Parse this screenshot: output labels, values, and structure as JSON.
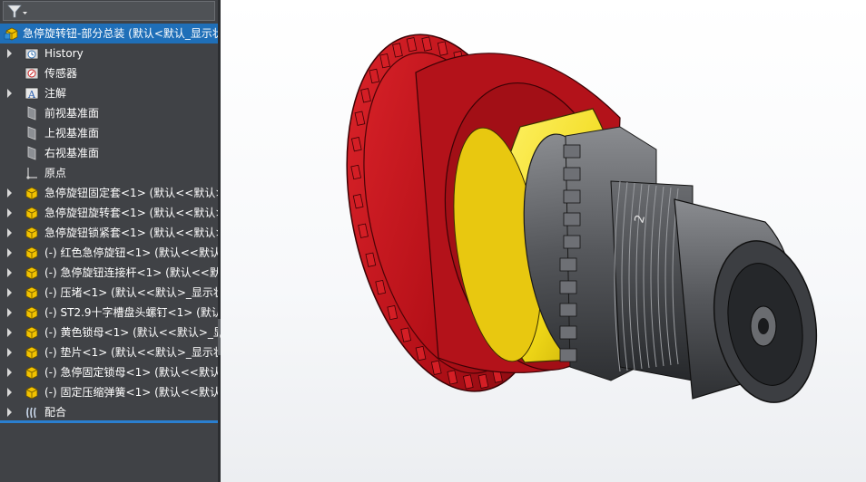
{
  "feature_tree": {
    "root": {
      "label": "急停旋转钮-部分总装  (默认<默认_显示状"
    },
    "items": [
      {
        "label": "History",
        "icon": "history-folder-icon",
        "expandable": true
      },
      {
        "label": "传感器",
        "icon": "sensor-icon",
        "expandable": false
      },
      {
        "label": "注解",
        "icon": "annotation-icon",
        "expandable": true
      },
      {
        "label": "前视基准面",
        "icon": "plane-icon",
        "expandable": false
      },
      {
        "label": "上视基准面",
        "icon": "plane-icon",
        "expandable": false
      },
      {
        "label": "右视基准面",
        "icon": "plane-icon",
        "expandable": false
      },
      {
        "label": "原点",
        "icon": "origin-icon",
        "expandable": false
      },
      {
        "label": "急停旋钮固定套<1> (默认<<默认>",
        "icon": "part-icon",
        "expandable": true
      },
      {
        "label": "急停旋钮旋转套<1> (默认<<默认>",
        "icon": "part-icon",
        "expandable": true
      },
      {
        "label": "急停旋钮锁紧套<1> (默认<<默认>",
        "icon": "part-icon",
        "expandable": true
      },
      {
        "label": "(-) 红色急停旋钮<1> (默认<<默认",
        "icon": "part-icon",
        "expandable": true
      },
      {
        "label": "(-) 急停旋钮连接杆<1> (默认<<默",
        "icon": "part-icon",
        "expandable": true
      },
      {
        "label": "(-) 压堵<1> (默认<<默认>_显示状",
        "icon": "part-icon",
        "expandable": true
      },
      {
        "label": "(-) ST2.9十字槽盘头螺钉<1> (默认",
        "icon": "part-icon",
        "expandable": true
      },
      {
        "label": "(-) 黄色锁母<1> (默认<<默认>_显",
        "icon": "part-icon",
        "expandable": true
      },
      {
        "label": "(-) 垫片<1> (默认<<默认>_显示状",
        "icon": "part-icon",
        "expandable": true
      },
      {
        "label": "(-) 急停固定锁母<1> (默认<<默认",
        "icon": "part-icon",
        "expandable": true
      },
      {
        "label": "(-) 固定压缩弹簧<1> (默认<<默认",
        "icon": "part-icon",
        "expandable": true
      },
      {
        "label": "配合",
        "icon": "mates-icon",
        "expandable": true
      }
    ]
  },
  "model": {
    "thread_marking": "2",
    "colors": {
      "button_red": "#c8141c",
      "lock_yellow": "#f5e31c",
      "body_gray": "#5a5c60",
      "panel_bg": "#404246",
      "selection_blue": "#1f6fb8"
    }
  }
}
